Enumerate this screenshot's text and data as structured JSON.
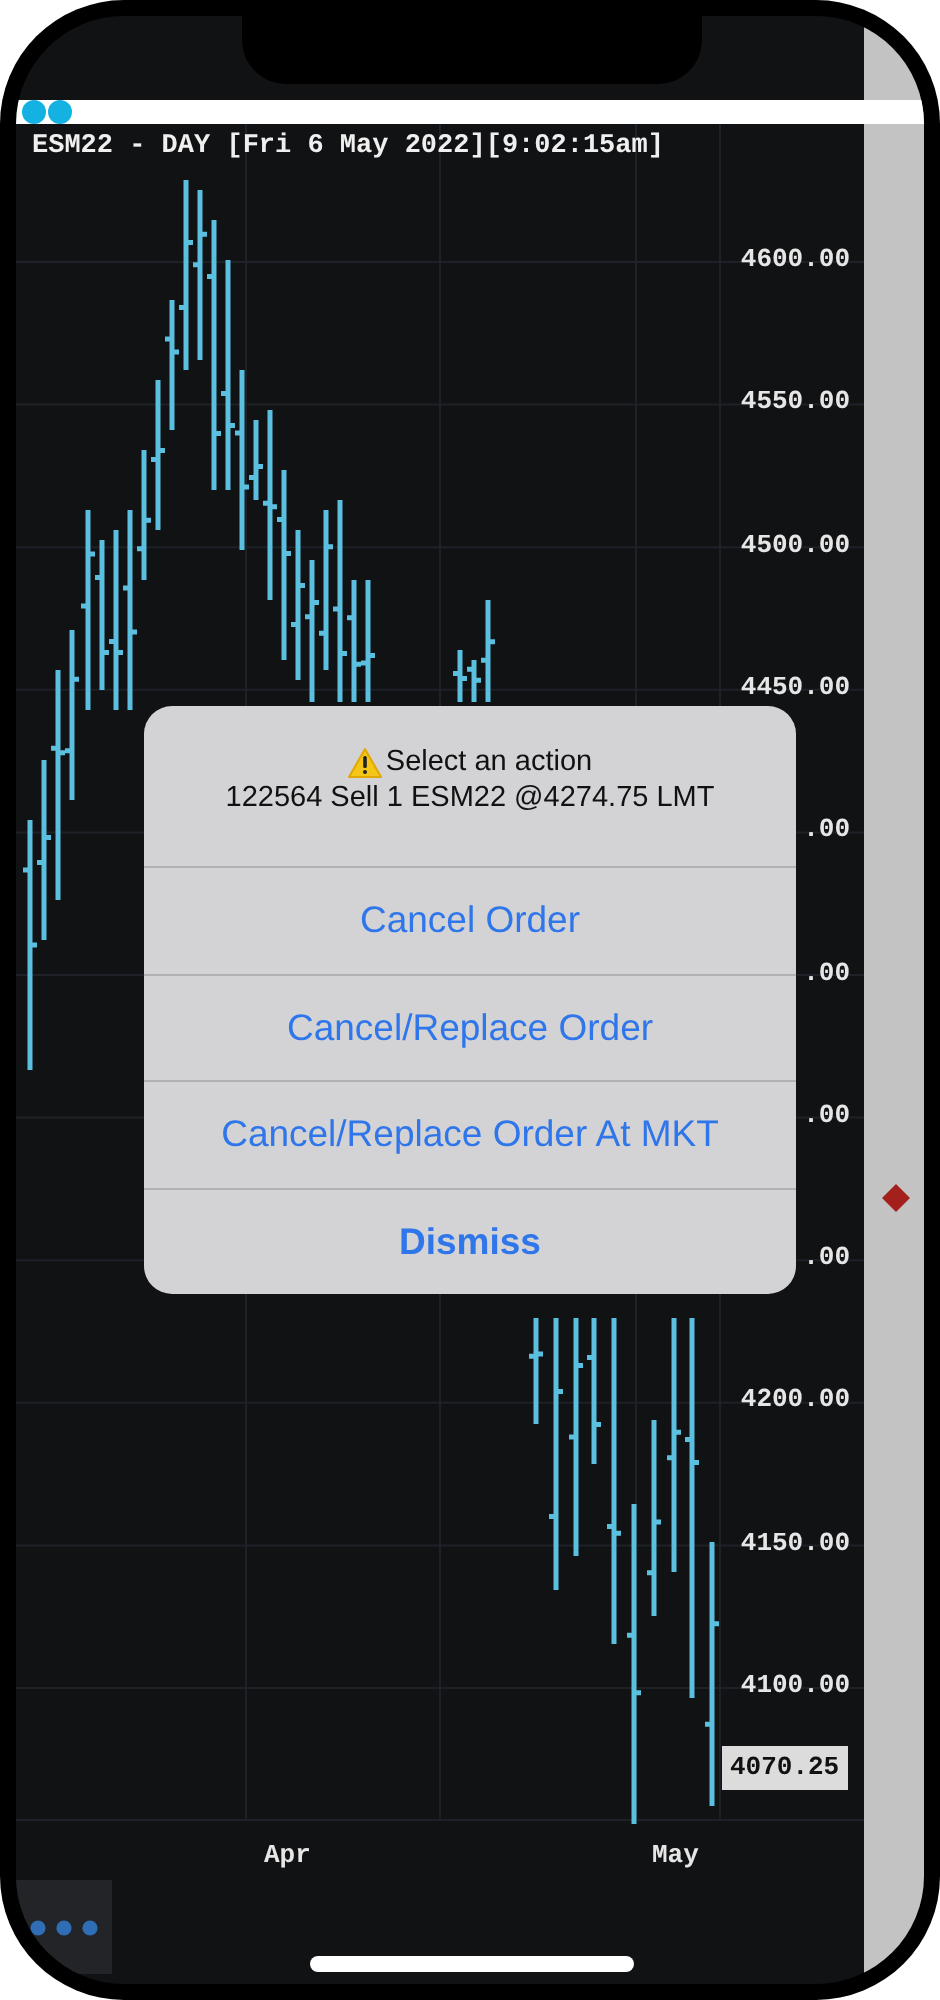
{
  "chart": {
    "title": "ESM22 - DAY [Fri 6 May 2022][9:02:15am]",
    "price_labels": [
      "4600.00",
      "4550.00",
      "4500.00",
      "4450.00",
      ".00",
      ".00",
      ".00",
      ".00",
      "4200.00",
      "4150.00",
      "4100.00"
    ],
    "current_price": "4070.25",
    "date_labels": [
      "Apr",
      "May"
    ]
  },
  "alert": {
    "title": "Select an action",
    "message": "122564 Sell 1 ESM22 @4274.75 LMT",
    "actions": [
      {
        "label": "Cancel Order",
        "kind": "default"
      },
      {
        "label": "Cancel/Replace Order",
        "kind": "default"
      },
      {
        "label": "Cancel/Replace Order At MKT",
        "kind": "default"
      },
      {
        "label": "Dismiss",
        "kind": "cancel"
      }
    ]
  }
}
